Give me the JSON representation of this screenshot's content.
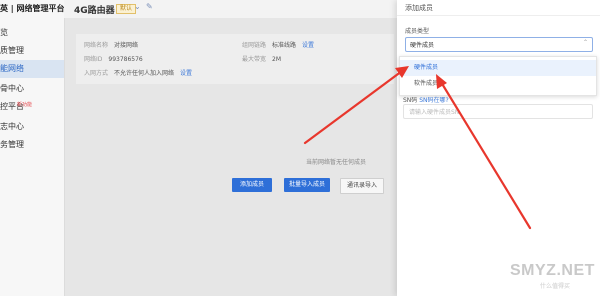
{
  "sidebar": {
    "brand": "英 | 网络管理平台",
    "items": [
      {
        "label": "览",
        "active": false
      },
      {
        "label": "质管理",
        "active": false
      },
      {
        "label": "能网络",
        "active": true
      },
      {
        "label": "骨中心",
        "active": false
      },
      {
        "label": "控平台",
        "active": false,
        "badge": "新功能"
      },
      {
        "label": "志中心",
        "active": false
      },
      {
        "label": "务管理",
        "active": false
      }
    ]
  },
  "header": {
    "device_title": "4G路由器",
    "device_tag": "默认",
    "dropdown_icon": "chevron-down-icon",
    "edit_icon": "edit-pencil-icon"
  },
  "info": {
    "network_name": {
      "key": "网络名称",
      "value": "对接网络"
    },
    "network_id": {
      "key": "网络ID",
      "value": "993786576"
    },
    "join_method": {
      "key": "入网方式",
      "value": "不允许任何人加入网络",
      "action": "设置"
    },
    "connection_type": {
      "key": "组网链路",
      "value": "标准线路",
      "action": "设置"
    },
    "bandwidth": {
      "key": "最大带宽",
      "value": "2M"
    }
  },
  "empty_state": {
    "text": "当前网络暂无任何成员"
  },
  "buttons": {
    "add_member": "添加成员",
    "batch_import": "批量导入成员",
    "address_book_import": "通讯录导入"
  },
  "drawer": {
    "title": "添加成员",
    "member_type_label": "成员类型",
    "member_type_value": "硬件成员",
    "options": [
      "硬件成员",
      "软件成员"
    ],
    "sn_label": "SN码",
    "sn_hint": "SN码在哪?",
    "sn_placeholder": "请输入硬件成员SN"
  },
  "annotation": {
    "arrow_color": "#e8372d"
  },
  "watermark": {
    "text": "SMYZ.NET",
    "sub": "什么值得买"
  }
}
